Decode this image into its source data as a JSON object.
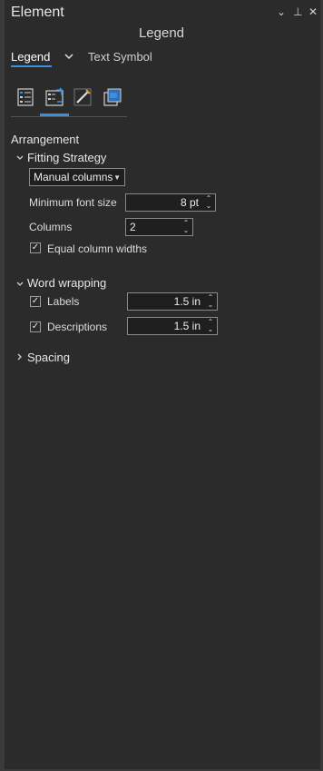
{
  "panel": {
    "title": "Element",
    "subtitle": "Legend",
    "controls": [
      "⌄",
      "⊥",
      "✕"
    ]
  },
  "tabs": [
    {
      "label": "Legend",
      "active": true
    },
    {
      "label": "Text Symbol",
      "active": false
    }
  ],
  "toolbar_icons": [
    "legend-items-icon",
    "arrangement-icon",
    "pen-icon",
    "display-icon"
  ],
  "arrangement": {
    "heading": "Arrangement",
    "fitting_strategy": {
      "heading": "Fitting Strategy",
      "selected": "Manual columns",
      "min_font_label": "Minimum font size",
      "min_font_value": "8 pt",
      "columns_label": "Columns",
      "columns_value": "2",
      "equal_widths_label": "Equal column widths",
      "equal_widths_checked": true
    },
    "word_wrapping": {
      "heading": "Word wrapping",
      "labels_label": "Labels",
      "labels_value": "1.5 in",
      "labels_checked": true,
      "descriptions_label": "Descriptions",
      "descriptions_value": "1.5 in",
      "descriptions_checked": true
    },
    "spacing": {
      "heading": "Spacing"
    }
  },
  "colors": {
    "background": "#2b2b2b",
    "accent": "#3a8fe0",
    "field_bg": "#1f1f1f"
  }
}
